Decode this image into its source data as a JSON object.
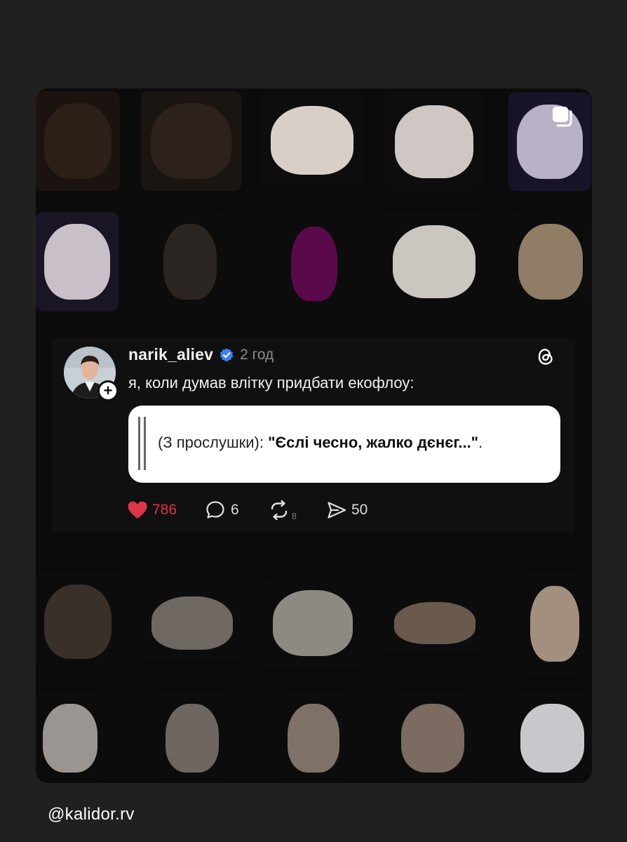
{
  "post": {
    "username": "narik_aliev",
    "time": "2 год",
    "text": "я, коли думав влітку придбати екофлоу:",
    "quote": {
      "prefix": "(З прослушки): ",
      "bold": "\"Єслі чесно, жалко дєнєг...\"",
      "suffix": "."
    },
    "likes": "786",
    "comments": "6",
    "reposts": "8",
    "shares": "50"
  },
  "icons": {
    "multi": "carousel-multiple-icon",
    "verified": "verified-badge-icon",
    "threads": "threads-logo-icon",
    "heart": "heart-icon",
    "comment": "comment-icon",
    "repost": "repost-icon",
    "share": "share-icon"
  },
  "colors": {
    "like": "#e0344a",
    "verified": "#3b82f6"
  },
  "credit": "@kalidor.rv"
}
